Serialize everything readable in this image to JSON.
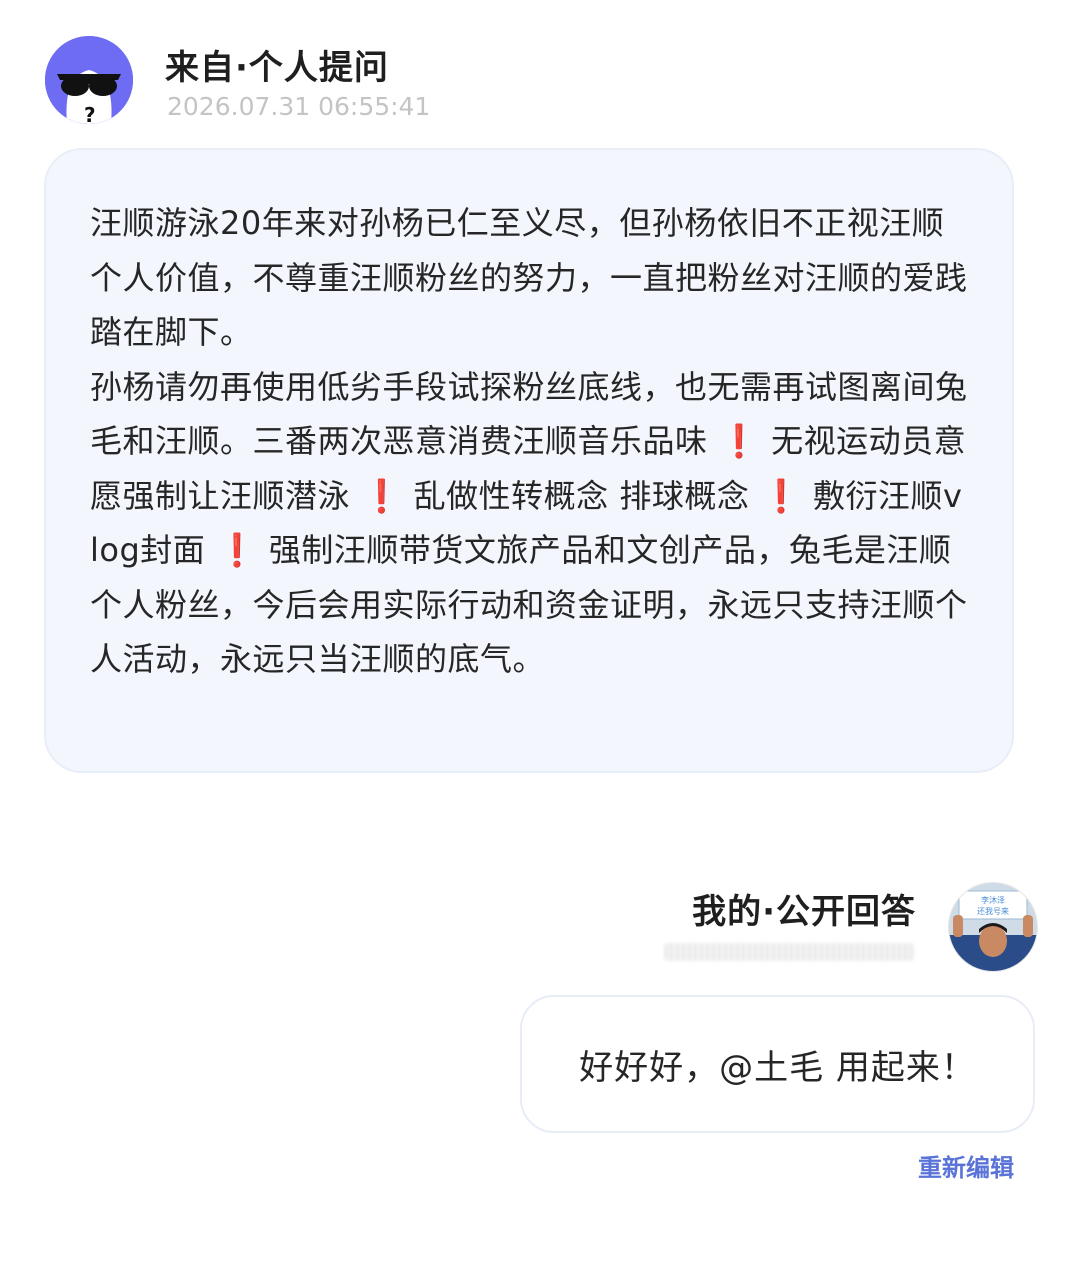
{
  "question": {
    "title": "来自·个人提问",
    "timestamp": "2026.07.31 06:55:41",
    "avatar_icon": "sunglasses-face-icon",
    "paragraphs": [
      [
        {
          "t": "汪顺游泳20年来对孙杨已仁至义尽，但孙杨依旧不正视汪顺个人价值，不尊重汪顺粉丝的努力，一直把粉丝对汪顺的爱践踏在脚下。"
        }
      ],
      [
        {
          "t": "孙杨请勿再使用低劣手段试探粉丝底线，也无需再试图离间兔毛和汪顺。三番两次恶意消费汪顺音乐品味"
        },
        {
          "t": "❗",
          "excl": true
        },
        {
          "t": "无视运动员意愿强制让汪顺潜泳"
        },
        {
          "t": "❗",
          "excl": true
        },
        {
          "t": "乱做性转概念 排球概念"
        },
        {
          "t": "❗",
          "excl": true
        },
        {
          "t": "敷衍汪顺vlog封面"
        },
        {
          "t": "❗",
          "excl": true
        },
        {
          "t": "强制汪顺带货文旅产品和文创产品，兔毛是汪顺个人粉丝，今后会用实际行动和资金证明，永远只支持汪顺个人活动，永远只当汪顺的底气。"
        }
      ]
    ]
  },
  "answer": {
    "title": "我的·公开回答",
    "avatar_icon": "user-photo-avatar",
    "avatar_sign_text": "李沐泽 还我号来",
    "text": "好好好，@土毛 用起来！",
    "edit_label": "重新编辑"
  },
  "colors": {
    "accent": "#5a73d8",
    "question_avatar_bg": "#6d6cf2",
    "bubble_bg": "#f3f7fd",
    "exclamation": "#e0282e"
  }
}
